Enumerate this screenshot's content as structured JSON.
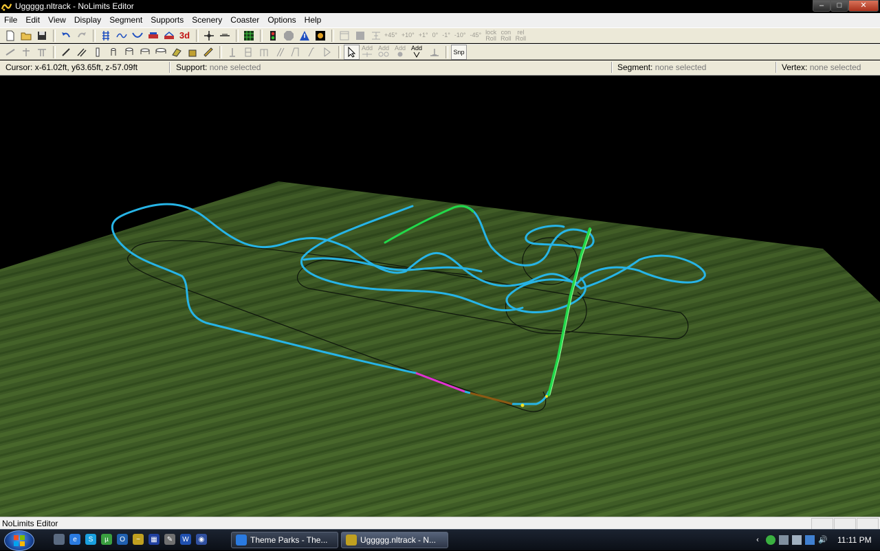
{
  "window": {
    "title": "Uggggg.nltrack - NoLimits Editor",
    "controls": {
      "minimize": "‒",
      "maximize": "□",
      "close": "✕"
    }
  },
  "menu": [
    "File",
    "Edit",
    "View",
    "Display",
    "Segment",
    "Supports",
    "Scenery",
    "Coaster",
    "Options",
    "Help"
  ],
  "toolbar1": {
    "label_3d": "3d",
    "angle_buttons": [
      "+45°",
      "+10°",
      "+1°",
      "0°",
      "-1°",
      "-10°",
      "-45°"
    ],
    "roll_buttons": [
      {
        "top": "lock",
        "bottom": "Roll"
      },
      {
        "top": "con",
        "bottom": "Roll"
      },
      {
        "top": "rel",
        "bottom": "Roll"
      }
    ]
  },
  "toolbar2": {
    "add_buttons": [
      "Add",
      "Add",
      "Add",
      "Add"
    ],
    "snap_label": "Snp"
  },
  "status": {
    "cursor_label": "Cursor:",
    "cursor_value": "x-61.02ft, y63.65ft, z-57.09ft",
    "support_label": "Support:",
    "support_value": "none selected",
    "segment_label": "Segment:",
    "segment_value": "none selected",
    "vertex_label": "Vertex:",
    "vertex_value": "none selected"
  },
  "bottom_status": "NoLimits Editor",
  "colors": {
    "track": "#27b4e6",
    "lift": "#22d84a",
    "station": "#e033d0",
    "brake": "#8a5a14",
    "ground": "#3c5a24",
    "shadow": "#101810"
  },
  "taskbar": {
    "tasks": [
      {
        "label": "Theme Parks - The...",
        "active": false
      },
      {
        "label": "Uggggg.nltrack - N...",
        "active": true
      }
    ],
    "clock": "11:11 PM"
  }
}
